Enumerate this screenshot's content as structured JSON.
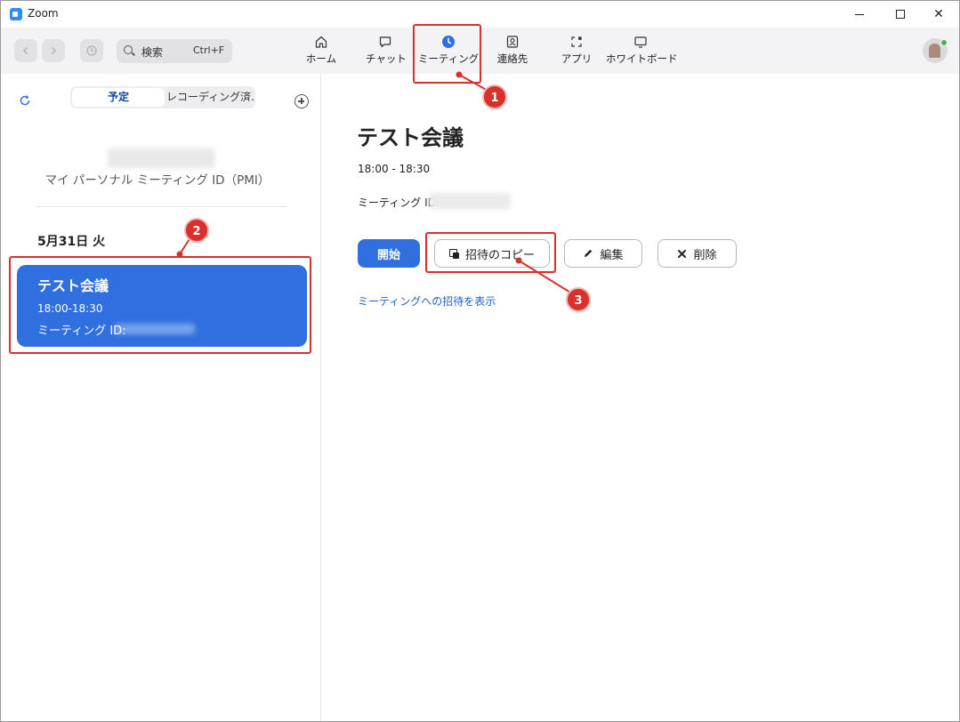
{
  "window": {
    "title": "Zoom",
    "minimize_label": "",
    "maximize_label": "",
    "close_label": "✕"
  },
  "toolbar": {
    "search_label": "検索",
    "search_shortcut": "Ctrl+F",
    "tabs": [
      {
        "label": "ホーム",
        "icon": "home-icon"
      },
      {
        "label": "チャット",
        "icon": "chat-icon"
      },
      {
        "label": "ミーティング",
        "icon": "clock-icon",
        "active": true
      },
      {
        "label": "連絡先",
        "icon": "contacts-icon"
      },
      {
        "label": "アプリ",
        "icon": "apps-icon"
      },
      {
        "label": "ホワイトボード",
        "icon": "whiteboard-icon"
      }
    ]
  },
  "sidebar": {
    "tab_scheduled": "予定",
    "tab_recorded": "レコーディング済...",
    "pmi_label": "マイ パーソナル ミーティング ID（PMI）",
    "date_label": "5月31日 火",
    "meeting": {
      "title": "テスト会議",
      "time": "18:00-18:30",
      "id_label": "ミーティング ID:"
    }
  },
  "main": {
    "title": "テスト会議",
    "time": "18:00 - 18:30",
    "id_label": "ミーティング ID:",
    "start_button": "開始",
    "copy_invite_button": "招待のコピー",
    "edit_button": "編集",
    "delete_button": "削除",
    "show_invite_link": "ミーティングへの招待を表示"
  },
  "annotations": {
    "step1": "1",
    "step2": "2",
    "step3": "3"
  },
  "colors": {
    "accent": "#2f6fe0",
    "annotation": "#d9302c",
    "link": "#1e63c9"
  }
}
